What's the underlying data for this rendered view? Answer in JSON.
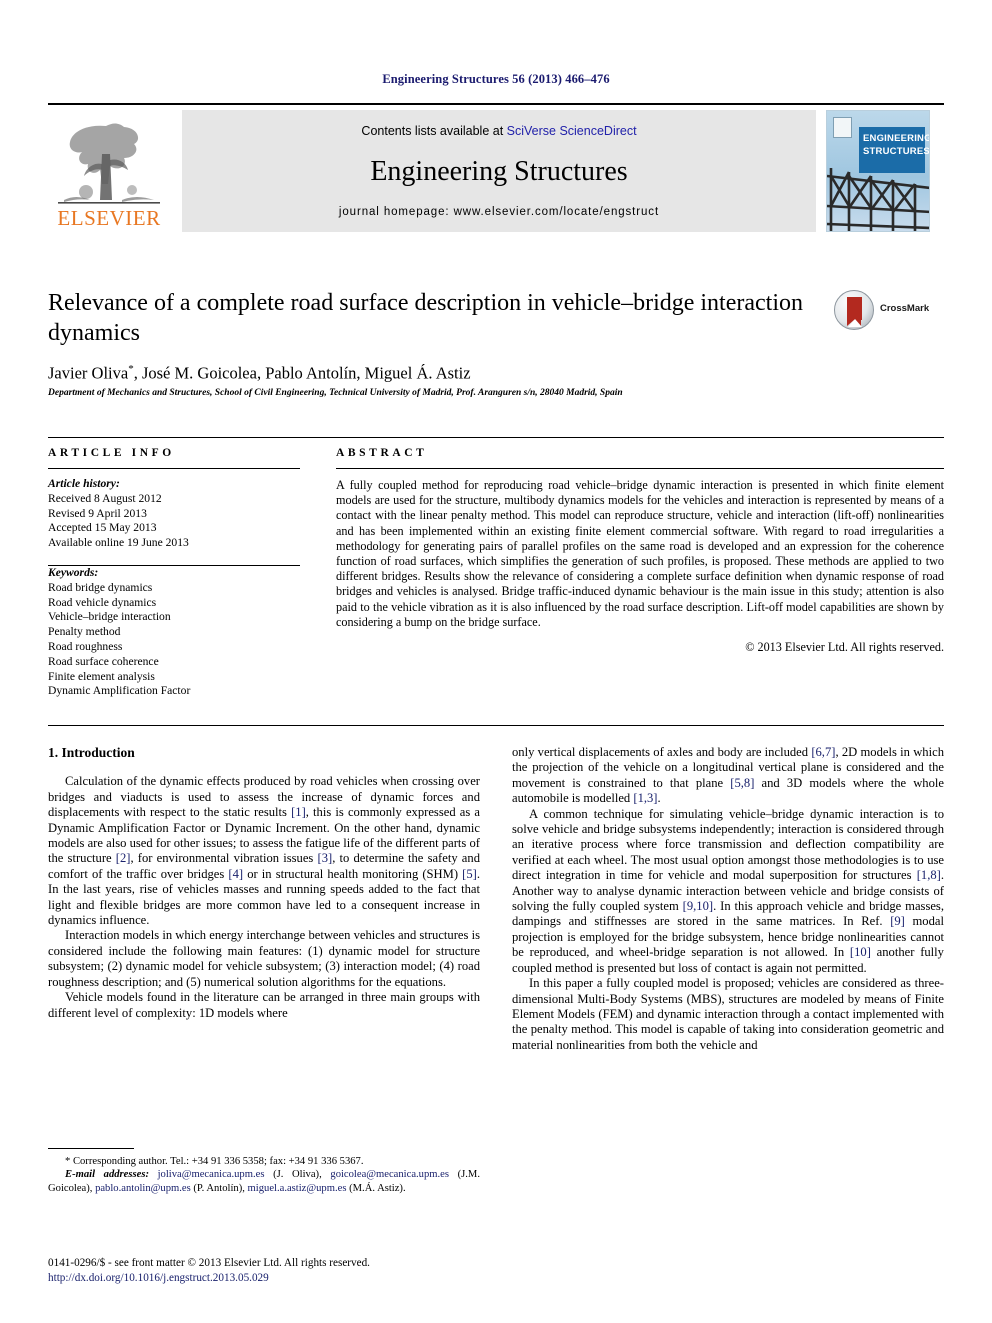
{
  "running_head": "Engineering Structures 56 (2013) 466–476",
  "banner": {
    "publisher_logo_name": "ELSEVIER",
    "contents_prefix": "Contents lists available at ",
    "contents_link": "SciVerse ScienceDirect",
    "journal_title": "Engineering Structures",
    "homepage": "journal homepage: www.elsevier.com/locate/engstruct",
    "cover_line1": "ENGINEERING",
    "cover_line2": "STRUCTURES"
  },
  "article": {
    "title": "Relevance of a complete road surface description in vehicle–bridge interaction dynamics",
    "authors": "Javier Oliva *, José M. Goicolea, Pablo Antolín, Miguel Á. Astiz",
    "affiliation": "Department of Mechanics and Structures, School of Civil Engineering, Technical University of Madrid, Prof. Aranguren s/n, 28040 Madrid, Spain",
    "crossmark_label": "CrossMark"
  },
  "info": {
    "heading": "ARTICLE INFO",
    "history_label": "Article history:",
    "history": [
      "Received 8 August 2012",
      "Revised 9 April 2013",
      "Accepted 15 May 2013",
      "Available online 19 June 2013"
    ],
    "keywords_label": "Keywords:",
    "keywords": [
      "Road bridge dynamics",
      "Road vehicle dynamics",
      "Vehicle–bridge interaction",
      "Penalty method",
      "Road roughness",
      "Road surface coherence",
      "Finite element analysis",
      "Dynamic Amplification Factor"
    ]
  },
  "abstract": {
    "heading": "ABSTRACT",
    "text": "A fully coupled method for reproducing road vehicle–bridge dynamic interaction is presented in which finite element models are used for the structure, multibody dynamics models for the vehicles and interaction is represented by means of a contact with the linear penalty method. This model can reproduce structure, vehicle and interaction (lift-off) nonlinearities and has been implemented within an existing finite element commercial software. With regard to road irregularities a methodology for generating pairs of parallel profiles on the same road is developed and an expression for the coherence function of road surfaces, which simplifies the generation of such profiles, is proposed. These methods are applied to two different bridges. Results show the relevance of considering a complete surface definition when dynamic response of road bridges and vehicles is analysed. Bridge traffic-induced dynamic behaviour is the main issue in this study; attention is also paid to the vehicle vibration as it is also influenced by the road surface description. Lift-off model capabilities are shown by considering a bump on the bridge surface.",
    "copyright": "© 2013 Elsevier Ltd. All rights reserved."
  },
  "body": {
    "section_heading": "1. Introduction",
    "left_paragraphs": [
      "Calculation of the dynamic effects produced by road vehicles when crossing over bridges and viaducts is used to assess the increase of dynamic forces and displacements with respect to the static results [1], this is commonly expressed as a Dynamic Amplification Factor or Dynamic Increment. On the other hand, dynamic models are also used for other issues; to assess the fatigue life of the different parts of the structure [2], for environmental vibration issues [3], to determine the safety and comfort of the traffic over bridges [4] or in structural health monitoring (SHM) [5]. In the last years, rise of vehicles masses and running speeds added to the fact that light and flexible bridges are more common have led to a consequent increase in dynamics influence.",
      "Interaction models in which energy interchange between vehicles and structures is considered include the following main features: (1) dynamic model for structure subsystem; (2) dynamic model for vehicle subsystem; (3) interaction model; (4) road roughness description; and (5) numerical solution algorithms for the equations.",
      "Vehicle models found in the literature can be arranged in three main groups with different level of complexity: 1D models where"
    ],
    "right_paragraphs": [
      "only vertical displacements of axles and body are included [6,7], 2D models in which the projection of the vehicle on a longitudinal vertical plane is considered and the movement is constrained to that plane [5,8] and 3D models where the whole automobile is modelled [1,3].",
      "A common technique for simulating vehicle–bridge dynamic interaction is to solve vehicle and bridge subsystems independently; interaction is considered through an iterative process where force transmission and deflection compatibility are verified at each wheel. The most usual option amongst those methodologies is to use direct integration in time for vehicle and modal superposition for structures [1,8]. Another way to analyse dynamic interaction between vehicle and bridge consists of solving the fully coupled system [9,10]. In this approach vehicle and bridge masses, dampings and stiffnesses are stored in the same matrices. In Ref. [9] modal projection is employed for the bridge subsystem, hence bridge nonlinearities cannot be reproduced, and wheel-bridge separation is not allowed. In [10] another fully coupled method is presented but loss of contact is again not permitted.",
      "In this paper a fully coupled model is proposed; vehicles are considered as three-dimensional Multi-Body Systems (MBS), structures are modeled by means of Finite Element Models (FEM) and dynamic interaction through a contact implemented with the penalty method. This model is capable of taking into consideration geometric and material nonlinearities from both the vehicle and"
    ]
  },
  "footnote": {
    "corresponding": "* Corresponding author. Tel.: +34 91 336 5358; fax: +34 91 336 5367.",
    "email_label": "E-mail addresses:",
    "emails": [
      {
        "address": "joliva@mecanica.upm.es",
        "person": "(J. Oliva)"
      },
      {
        "address": "goicolea@mecanica.upm.es",
        "person": "(J.M. Goicolea)"
      },
      {
        "address": "pablo.antolin@upm.es",
        "person": "(P. Antolín)"
      },
      {
        "address": "miguel.a.astiz@upm.es",
        "person": "(M.Á. Astiz)"
      }
    ],
    "issn_line": "0141-0296/$ - see front matter © 2013 Elsevier Ltd. All rights reserved.",
    "doi": "http://dx.doi.org/10.1016/j.engstruct.2013.05.029"
  },
  "colors": {
    "link": "#19216c",
    "sciencedirect": "#2222aa",
    "elsevier_orange": "#E87722",
    "cover_blue": "#1b6ca8",
    "crossmark_red": "#b3291f",
    "running_head": "#1a1a6e"
  }
}
